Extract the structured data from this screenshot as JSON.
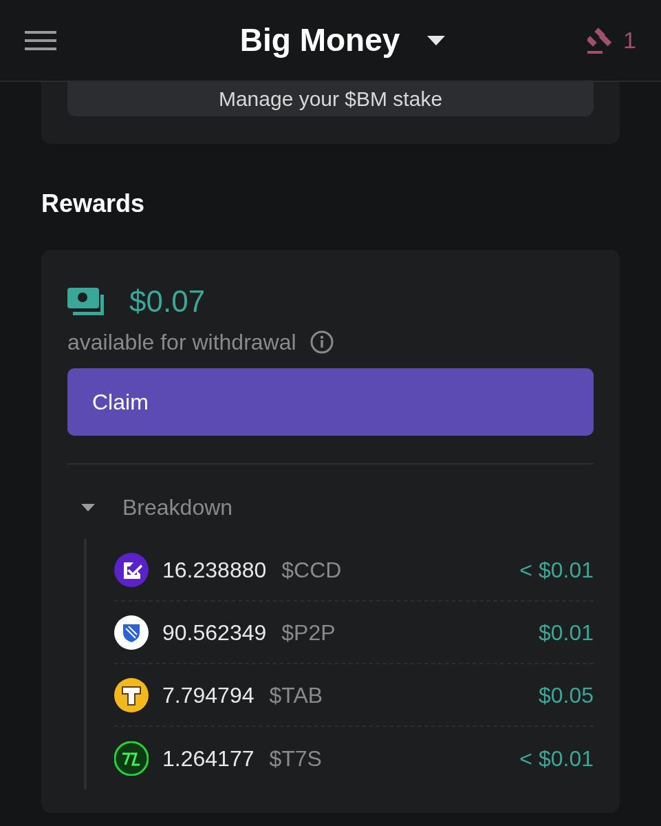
{
  "header": {
    "title": "Big Money",
    "badge_count": "1"
  },
  "stake_button": {
    "label": "Manage your $BM stake"
  },
  "rewards": {
    "heading": "Rewards",
    "amount": "$0.07",
    "caption": "available for withdrawal",
    "claim_label": "Claim",
    "breakdown": {
      "label": "Breakdown",
      "expanded": true,
      "tokens": [
        {
          "kind": "ccd",
          "amount": "16.238880",
          "symbol": "$CCD",
          "value": "< $0.01"
        },
        {
          "kind": "p2p",
          "amount": "90.562349",
          "symbol": "$P2P",
          "value": "$0.01"
        },
        {
          "kind": "tab",
          "amount": "7.794794",
          "symbol": "$TAB",
          "value": "$0.05"
        },
        {
          "kind": "t7s",
          "amount": "1.264177",
          "symbol": "$T7S",
          "value": "< $0.01"
        }
      ]
    }
  }
}
